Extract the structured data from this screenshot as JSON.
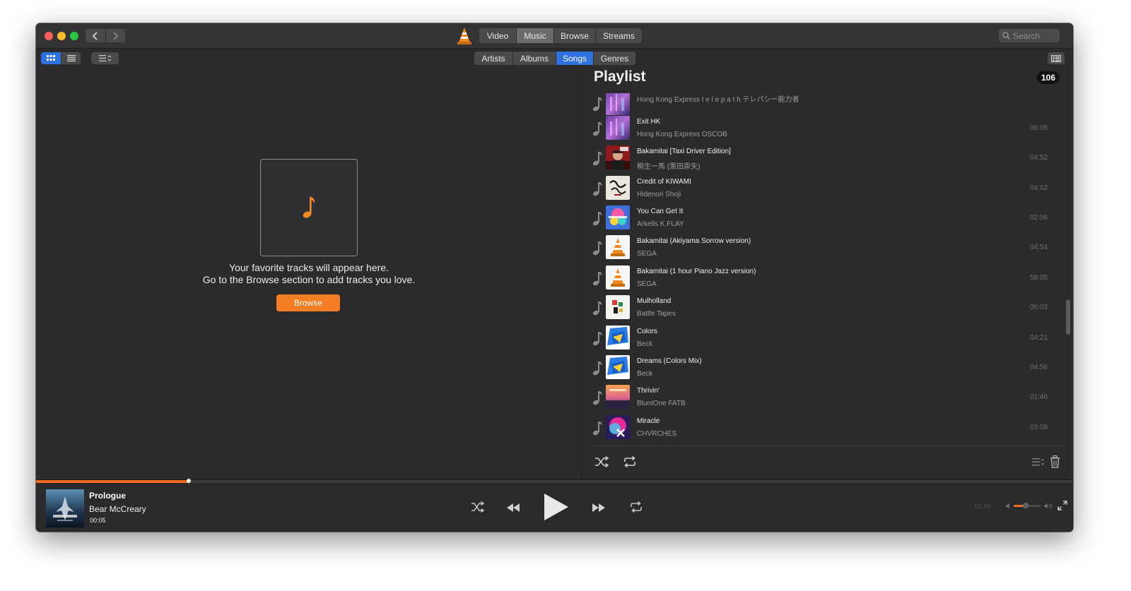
{
  "colors": {
    "accent": "#f27d22",
    "selected_segment": "#2e72e0",
    "window_bg": "#2b2b2d",
    "traffic_red": "#fe5f57",
    "traffic_yellow": "#febc2e",
    "traffic_green": "#28c840"
  },
  "titlebar": {
    "tabs": [
      {
        "label": "Video",
        "selected": false
      },
      {
        "label": "Music",
        "selected": true
      },
      {
        "label": "Browse",
        "selected": false
      },
      {
        "label": "Streams",
        "selected": false
      }
    ],
    "search_placeholder": "Search",
    "icons": [
      "back-icon",
      "forward-icon",
      "vlc-cone-icon",
      "search-icon"
    ]
  },
  "subtoolbar": {
    "view_modes": [
      "grid-view-icon",
      "list-view-icon"
    ],
    "sort_icon": "sort-options-icon",
    "tabs": [
      {
        "label": "Artists",
        "selected": false
      },
      {
        "label": "Albums",
        "selected": false
      },
      {
        "label": "Songs",
        "selected": true
      },
      {
        "label": "Genres",
        "selected": false
      }
    ],
    "playlist_toggle_icon": "playlist-toggle-icon"
  },
  "main": {
    "placeholder_icon": "music-note-icon",
    "message_line1": "Your favorite tracks will appear here.",
    "message_line2": "Go to the Browse section to add tracks you love.",
    "browse_button": "Browse"
  },
  "playlist": {
    "title": "Playlist",
    "count": "106",
    "items": [
      {
        "title": "",
        "artist": "Hong Kong Express t e l e p a t h テレパシー能力者",
        "duration": "",
        "art": "art-purple"
      },
      {
        "title": "Exit HK",
        "artist": "Hong Kong Express OSCOB",
        "duration": "06:05",
        "art": "art-purple"
      },
      {
        "title": "Bakamitai [Taxi Driver Edition]",
        "artist": "桐生一馬 (黒田崇矢)",
        "duration": "04:52",
        "art": "art-red"
      },
      {
        "title": "Credit of KIWAMI",
        "artist": "Hidenori Shoji",
        "duration": "04:52",
        "art": "art-calligraphy"
      },
      {
        "title": "You Can Get It",
        "artist": "Arkells K.FLAY",
        "duration": "02:56",
        "art": "art-colorful"
      },
      {
        "title": "Bakamitai (Akiyama Sorrow version)",
        "artist": "SEGA",
        "duration": "04:54",
        "art": "art-vlc"
      },
      {
        "title": "Bakamitai (1 hour Piano Jazz version)",
        "artist": "SEGA",
        "duration": "58:05",
        "art": "art-vlc"
      },
      {
        "title": "Mulholland",
        "artist": "Battle Tapes",
        "duration": "06:03",
        "art": "art-mulholland"
      },
      {
        "title": "Colors",
        "artist": "Beck",
        "duration": "04:21",
        "art": "art-beck"
      },
      {
        "title": "Dreams (Colors Mix)",
        "artist": "Beck",
        "duration": "04:56",
        "art": "art-beck"
      },
      {
        "title": "Thrivin'",
        "artist": "BluntOne FATB",
        "duration": "01:46",
        "art": "art-sunset"
      },
      {
        "title": "Miracle",
        "artist": "CHVRCHES",
        "duration": "03:08",
        "art": "art-miracle"
      }
    ],
    "footer_icons": [
      "shuffle-icon",
      "repeat-icon",
      "playlist-sort-icon",
      "trash-icon"
    ]
  },
  "now_playing": {
    "title": "Prologue",
    "artist": "Bear McCreary",
    "elapsed": "00:05",
    "remaining": "00:00",
    "progress_fraction": 0.147,
    "volume_fraction": 0.45,
    "controls": [
      "shuffle-icon",
      "rewind-icon",
      "play-icon",
      "fast-forward-icon",
      "repeat-icon"
    ],
    "extra_icons": [
      "volume-low-icon",
      "volume-high-icon",
      "fullscreen-icon"
    ]
  }
}
